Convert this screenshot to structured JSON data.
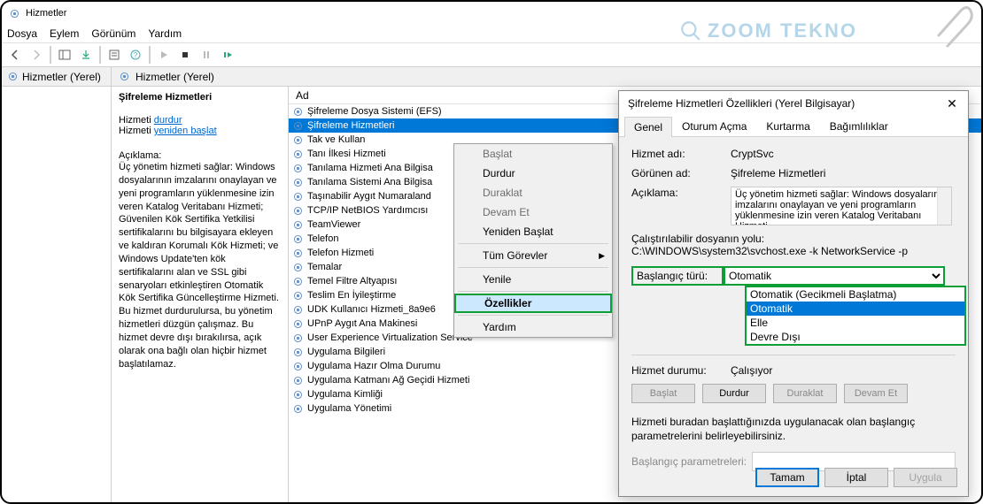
{
  "window": {
    "title": "Hizmetler"
  },
  "menus": {
    "file": "Dosya",
    "action": "Eylem",
    "view": "Görünüm",
    "help": "Yardım"
  },
  "leftpane": {
    "title": "Hizmetler (Yerel)"
  },
  "midheader": {
    "title": "Hizmetler (Yerel)"
  },
  "detail": {
    "title": "Şifreleme Hizmetleri",
    "stop_label_prefix": "Hizmeti ",
    "stop_link": "durdur",
    "restart_label_prefix": "Hizmeti ",
    "restart_link": "yeniden başlat",
    "desc_label": "Açıklama:",
    "desc_text": "Üç yönetim hizmeti sağlar: Windows dosyalarının imzalarını onaylayan ve yeni programların yüklenmesine izin veren Katalog Veritabanı Hizmeti; Güvenilen Kök Sertifika Yetkilisi sertifikalarını bu bilgisayara ekleyen ve kaldıran Korumalı Kök Hizmeti; ve Windows Update'ten kök sertifikalarını alan ve SSL gibi senaryoları etkinleştiren Otomatik Kök Sertifika Güncelleştirme Hizmeti. Bu hizmet durdurulursa, bu yönetim hizmetleri düzgün çalışmaz. Bu hizmet devre dışı bırakılırsa, açık olarak ona bağlı olan hiçbir hizmet başlatılamaz."
  },
  "list": {
    "header": "Ad",
    "items": [
      "Şifreleme Dosya Sistemi (EFS)",
      "Şifreleme Hizmetleri",
      "Tak ve Kullan",
      "Tanı İlkesi Hizmeti",
      "Tanılama Hizmeti Ana Bilgisa",
      "Tanılama Sistemi Ana Bilgisa",
      "Taşınabilir Aygıt Numaraland",
      "TCP/IP NetBIOS Yardımcısı",
      "TeamViewer",
      "Telefon",
      "Telefon Hizmeti",
      "Temalar",
      "Temel Filtre Altyapısı",
      "Teslim En İyileştirme",
      "UDK Kullanıcı Hizmeti_8a9e6",
      "UPnP Aygıt Ana Makinesi",
      "User Experience Virtualization Service",
      "Uygulama Bilgileri",
      "Uygulama Hazır Olma Durumu",
      "Uygulama Katmanı Ağ Geçidi Hizmeti",
      "Uygulama Kimliği",
      "Uygulama Yönetimi"
    ]
  },
  "context_menu": {
    "start": "Başlat",
    "stop": "Durdur",
    "pause": "Duraklat",
    "resume": "Devam Et",
    "restart": "Yeniden Başlat",
    "all_tasks": "Tüm Görevler",
    "refresh": "Yenile",
    "properties": "Özellikler",
    "help": "Yardım"
  },
  "dialog": {
    "title": "Şifreleme Hizmetleri Özellikleri (Yerel Bilgisayar)",
    "tabs": {
      "general": "Genel",
      "logon": "Oturum Açma",
      "recovery": "Kurtarma",
      "deps": "Bağımlılıklar"
    },
    "service_name_lbl": "Hizmet adı:",
    "service_name": "CryptSvc",
    "display_name_lbl": "Görünen ad:",
    "display_name": "Şifreleme Hizmetleri",
    "desc_lbl": "Açıklama:",
    "desc_text": "Üç yönetim hizmeti sağlar: Windows dosyalarının imzalarını onaylayan ve yeni programların yüklenmesine izin veren Katalog Veritabanı Hizmeti",
    "exe_lbl": "Çalıştırılabilir dosyanın yolu:",
    "exe_path": "C:\\WINDOWS\\system32\\svchost.exe -k NetworkService -p",
    "startup_lbl": "Başlangıç türü:",
    "startup_value": "Otomatik",
    "startup_options": [
      "Otomatik (Gecikmeli Başlatma)",
      "Otomatik",
      "Elle",
      "Devre Dışı"
    ],
    "status_lbl": "Hizmet durumu:",
    "status_val": "Çalışıyor",
    "btn_start": "Başlat",
    "btn_stop": "Durdur",
    "btn_pause": "Duraklat",
    "btn_resume": "Devam Et",
    "param_hint": "Hizmeti buradan başlattığınızda uygulanacak olan başlangıç parametrelerini belirleyebilirsiniz.",
    "param_lbl": "Başlangıç parametreleri:",
    "ok": "Tamam",
    "cancel": "İptal",
    "apply": "Uygula"
  },
  "brand": {
    "text": "ZOOM TEKNO"
  }
}
